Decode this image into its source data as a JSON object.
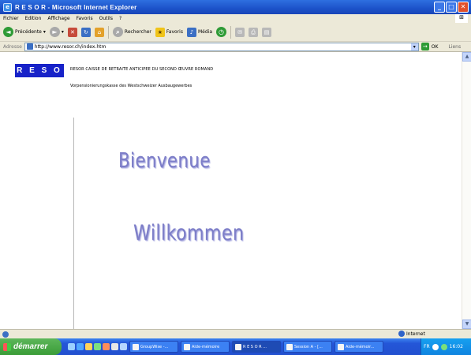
{
  "window": {
    "title": "R E S O R - Microsoft Internet Explorer",
    "buttons": {
      "minimize": "_",
      "maximize": "□",
      "close": "✕"
    }
  },
  "menu": {
    "items": [
      "Fichier",
      "Edition",
      "Affichage",
      "Favoris",
      "Outils",
      "?"
    ]
  },
  "toolbar": {
    "back_label": "Précédente",
    "search_label": "Rechercher",
    "favorites_label": "Favoris",
    "media_label": "Média"
  },
  "address": {
    "label": "Adresse",
    "url": "http://www.resor.ch/index.htm",
    "go_label": "OK",
    "links_label": "Liens"
  },
  "page": {
    "logo": "R E S O R",
    "org_name_fr": "RESOR CAISSE DE RETRAITE ANTICIPEE DU SECOND ŒUVRE ROMAND",
    "org_name_de": "Vorpensionierungskasse des Westschweizer Ausbaugewerbes",
    "welcome_fr": "Bienvenue",
    "welcome_de": "Willkommen",
    "welcome_color": "#7d7ec8",
    "logo_color": "#1722c8"
  },
  "status": {
    "zone": "Internet"
  },
  "taskbar": {
    "start_label": "démarrer",
    "tasks": [
      "GroupWise -...",
      "Aide-mémoire",
      "R E S O R ...",
      "Session A - [...",
      "Aide-mémoir..."
    ],
    "language": "FR",
    "clock": "16:02"
  }
}
